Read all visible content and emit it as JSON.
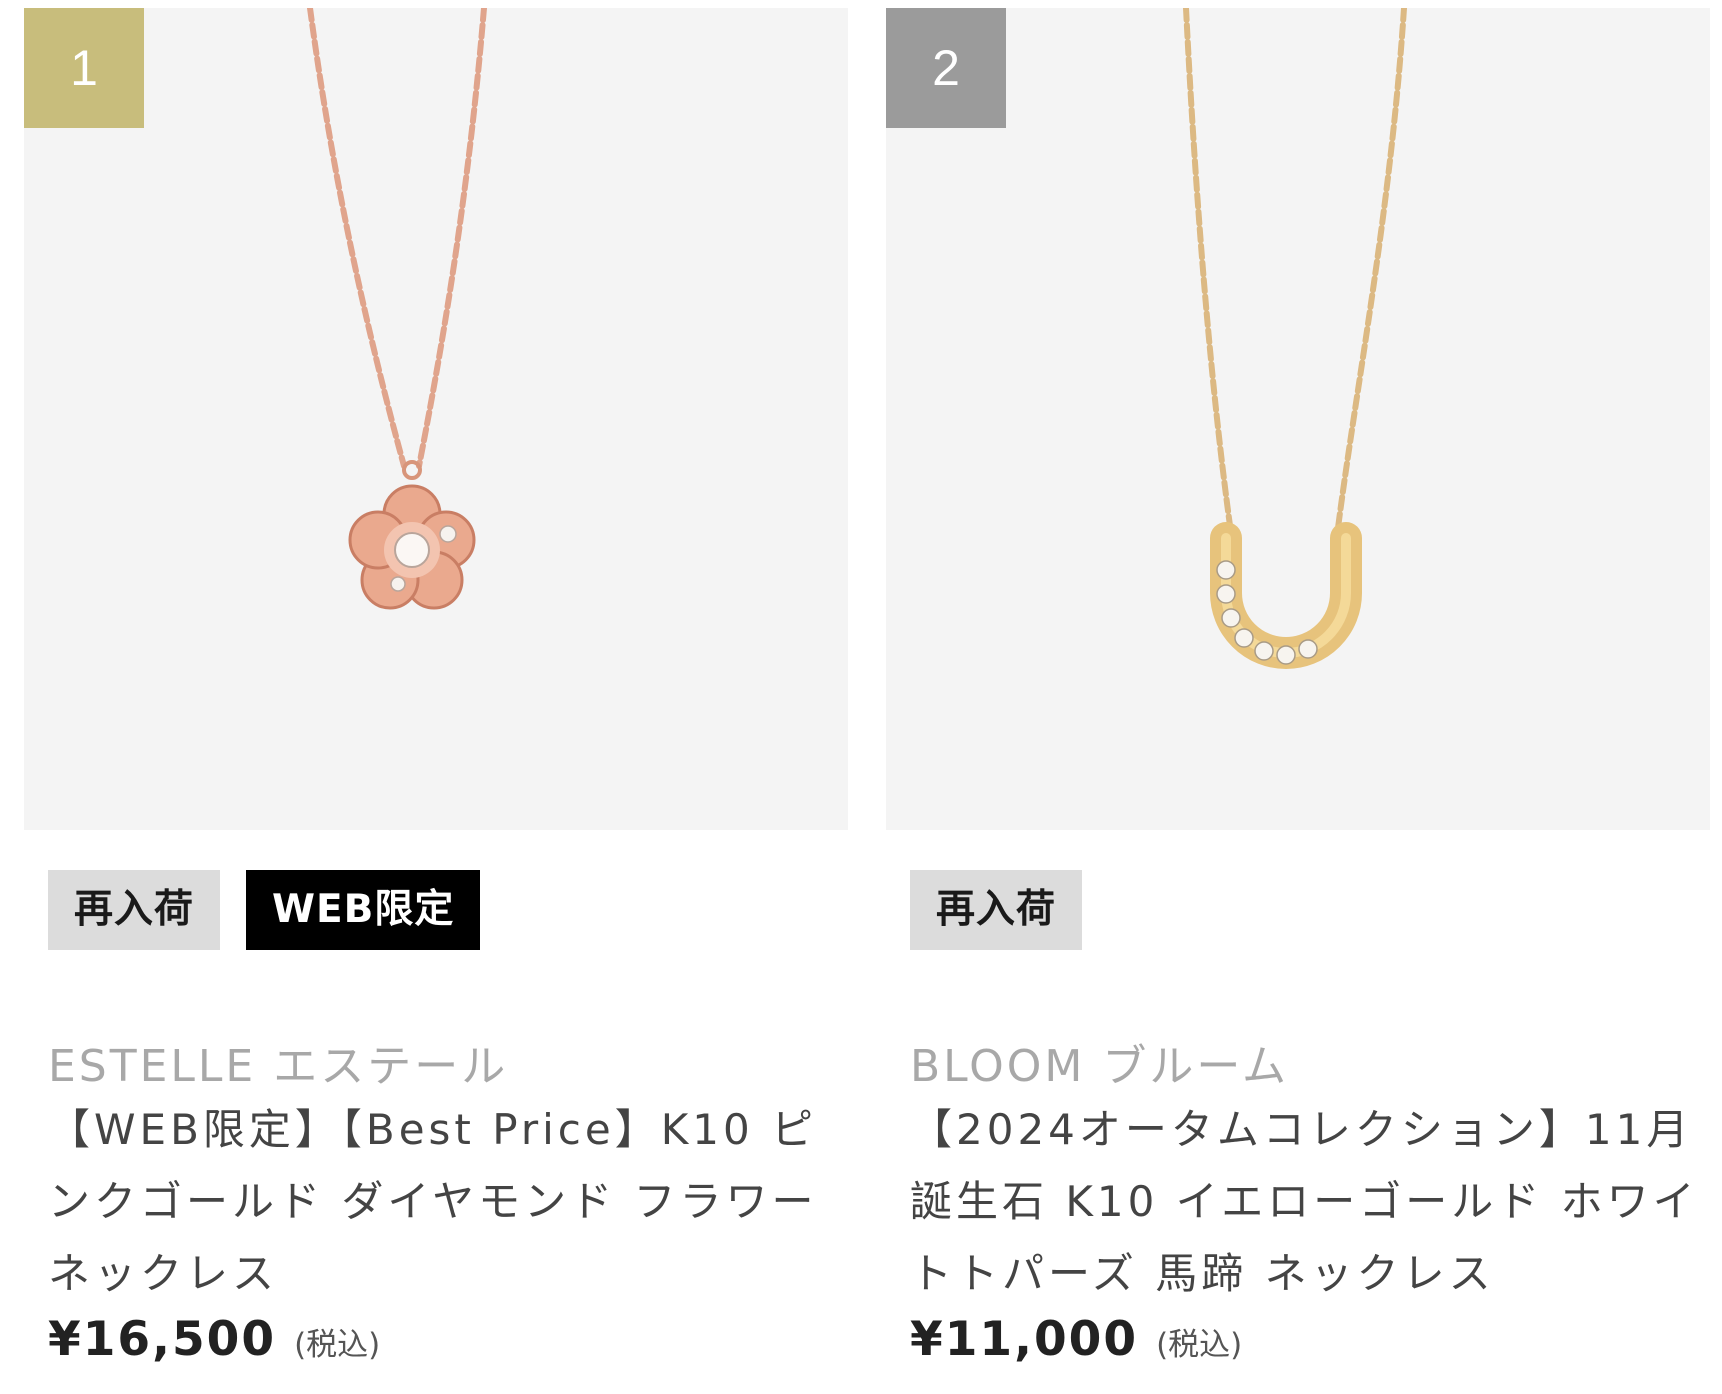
{
  "colors": {
    "rank_1": "#c8bd7c",
    "rank_2": "#9b9b9b",
    "image_bg": "#f4f4f4",
    "tag_restock_bg": "#dcdcdc",
    "tag_web_bg": "#000000"
  },
  "products": [
    {
      "rank": "1",
      "tags": [
        "再入荷",
        "WEB限定"
      ],
      "brand": "ESTELLE エステール",
      "name": "【WEB限定】【Best Price】K10 ピンクゴールド ダイヤモンド フラワー ネックレス",
      "price": "¥16,500",
      "tax_note": "(税込)",
      "image_icon": "flower-pendant-necklace"
    },
    {
      "rank": "2",
      "tags": [
        "再入荷"
      ],
      "brand": "BLOOM ブルーム",
      "name": "【2024オータムコレクション】11月誕生石 K10 イエローゴールド ホワイトトパーズ 馬蹄 ネックレス",
      "price": "¥11,000",
      "tax_note": "(税込)",
      "image_icon": "horseshoe-pendant-necklace"
    }
  ]
}
